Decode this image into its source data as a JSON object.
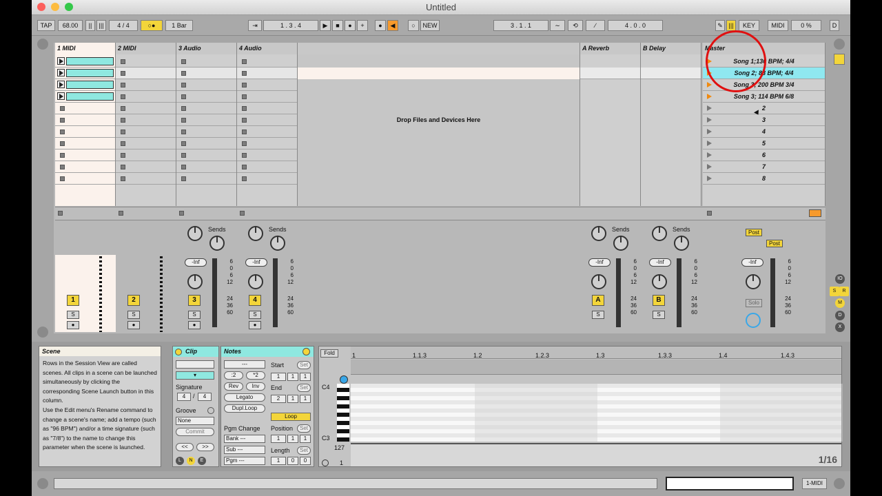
{
  "window": {
    "title": "Untitled"
  },
  "toolbar": {
    "tap": "TAP",
    "tempo": "68.00",
    "signature_num": "4",
    "signature_den": "4",
    "sig_sep": "/",
    "metronome": "○●",
    "quantize": "1 Bar",
    "follow": "⇥",
    "position": "1 .  3 .  4",
    "play": "▶",
    "stop": "■",
    "record": "●",
    "add": "+",
    "new": "NEW",
    "loop_start": "3 .  1 .  1",
    "loop_length": "4 .  0 .  0",
    "key": "KEY",
    "midi": "MIDI",
    "cpu": "0 %",
    "d": "D"
  },
  "tracks": [
    {
      "name": "1 MIDI",
      "num": "1"
    },
    {
      "name": "2 MIDI",
      "num": "2"
    },
    {
      "name": "3 Audio",
      "num": "3"
    },
    {
      "name": "4 Audio",
      "num": "4"
    }
  ],
  "returns": [
    {
      "name": "A Reverb",
      "num": "A"
    },
    {
      "name": "B Delay",
      "num": "B"
    }
  ],
  "master": {
    "name": "Master",
    "solo": "Solo",
    "post1": "Post",
    "post2": "Post"
  },
  "scenes": [
    "Song 1;130 BPM; 4/4",
    "Song 2; 88 BPM; 4/4",
    "Song 3; 200 BPM 3/4",
    "Song 3; 114 BPM 6/8",
    "2",
    "3",
    "4",
    "5",
    "6",
    "7",
    "8"
  ],
  "drop_text": "Drop Files and Devices Here",
  "mixer": {
    "sends": "Sends",
    "send_a": "A",
    "send_b": "B",
    "inf": "-Inf",
    "solo": "S",
    "scale": [
      "6",
      "0",
      "6",
      "12",
      "24",
      "36",
      "60"
    ]
  },
  "info": {
    "title": "Scene",
    "body": "Rows in the Session View are called scenes. All clips in a scene can be launched simultaneously by clicking the corresponding Scene Launch button in this column.\nUse the Edit menu's Rename command to change a scene's name; add a tempo (such as \"96 BPM\") and/or a time signature (such as \"7/8\") to the name to change this parameter when the scene is launched."
  },
  "clip": {
    "title": "Clip",
    "signature": "Signature",
    "sig_num": "4",
    "sig_den": "4",
    "sig_sep": "/",
    "groove": "Groove",
    "groove_val": "None",
    "commit": "Commit",
    "nav_prev": "<<",
    "nav_next": ">>"
  },
  "notes": {
    "title": "Notes",
    "dash": "---",
    "div2": ":2",
    "mul2": "*2",
    "rev": "Rev",
    "inv": "Inv",
    "legato": "Legato",
    "dupl": "Dupl.Loop",
    "start": "Start",
    "end": "End",
    "set": "Set",
    "loop": "Loop",
    "position": "Position",
    "length": "Length",
    "pgm_change": "Pgm Change",
    "bank": "Bank ---",
    "sub": "Sub ---",
    "pgm": "Pgm ---",
    "start_vals": [
      "1",
      "1",
      "1"
    ],
    "end_vals": [
      "2",
      "1",
      "1"
    ],
    "pos_vals": [
      "1",
      "1",
      "1"
    ],
    "len_vals": [
      "1",
      "0",
      "0"
    ]
  },
  "editor": {
    "fold": "Fold",
    "ruler": [
      "1",
      "1.1.3",
      "1.2",
      "1.2.3",
      "1.3",
      "1.3.3",
      "1.4",
      "1.4.3"
    ],
    "c4": "C4",
    "c3": "C3",
    "vel_max": "127",
    "vel_min": "1",
    "grid": "1/16"
  },
  "status": {
    "track": "1-MIDI"
  }
}
